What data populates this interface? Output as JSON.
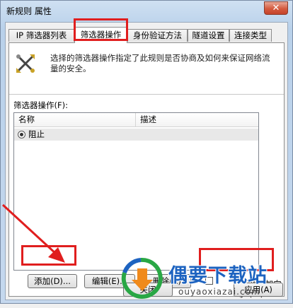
{
  "window": {
    "title": "新规则 属性",
    "close_glyph": "✕"
  },
  "tabs": [
    {
      "label": "IP 筛选器列表",
      "active": false
    },
    {
      "label": "筛选器操作",
      "active": true
    },
    {
      "label": "身份验证方法",
      "active": false
    },
    {
      "label": "隧道设置",
      "active": false
    },
    {
      "label": "连接类型",
      "active": false
    }
  ],
  "panel": {
    "icon": "crossed-tools-icon",
    "description": "选择的筛选器操作指定了此规则是否协商及如何来保证网络流量的安全。",
    "list_label": "筛选器操作(F):",
    "columns": [
      "名称",
      "描述"
    ],
    "rows": [
      {
        "name": "阻止",
        "description": "",
        "selected": true
      }
    ]
  },
  "buttons": {
    "add": "添加(D)...",
    "edit": "编辑(E)...",
    "delete": "删除(R)",
    "close": "关闭",
    "apply": "应用(A)"
  },
  "wizard": {
    "label_line1": "使用“添加向",
    "label_line2": "导”(W)",
    "checked": false
  },
  "watermark": {
    "name": "偶要下载站",
    "url": "ouyaoxiazai.com"
  },
  "colors": {
    "highlight": "#e01e1e",
    "brand": "#1d63c0"
  }
}
